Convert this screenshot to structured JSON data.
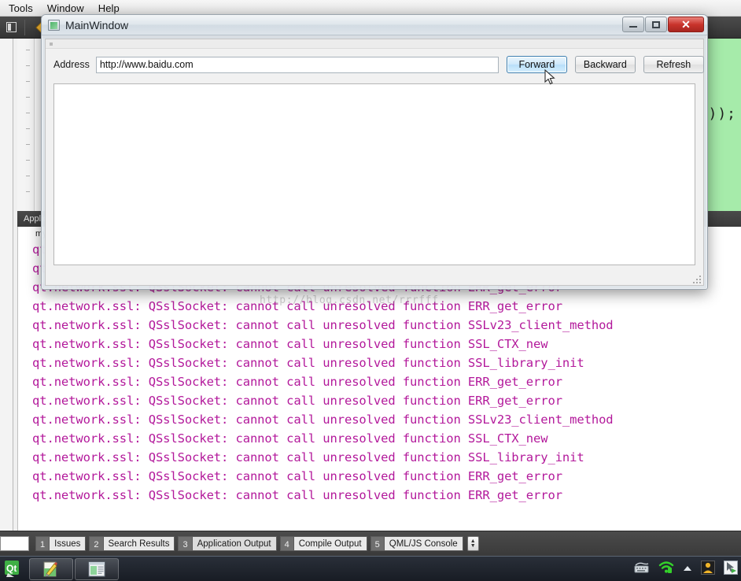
{
  "ide": {
    "menubar": [
      {
        "label": "Tools"
      },
      {
        "label": "Window"
      },
      {
        "label": "Help"
      }
    ],
    "toolbar_icons": [
      {
        "name": "panel-toggle-icon",
        "glyph": "▣"
      },
      {
        "name": "diamond-marker-icon",
        "glyph": "♦"
      }
    ],
    "editor": {
      "code_fragment": "));"
    },
    "output_pane": {
      "tab_label": "Application Output",
      "first_line": "myW",
      "log_prefix": "qt.network.ssl: QSslSocket: cannot call unresolved function ",
      "log_lines": [
        "qt.network.ssl: QSslSocket: cannot call unresolved function ERR_get_error",
        "qt.network.ssl: QSslSocket: cannot call unresolved function ERR_get_error",
        "qt.network.ssl: QSslSocket: cannot call unresolved function ERR_get_error",
        "qt.network.ssl: QSslSocket: cannot call unresolved function ERR_get_error",
        "qt.network.ssl: QSslSocket: cannot call unresolved function SSLv23_client_method",
        "qt.network.ssl: QSslSocket: cannot call unresolved function SSL_CTX_new",
        "qt.network.ssl: QSslSocket: cannot call unresolved function SSL_library_init",
        "qt.network.ssl: QSslSocket: cannot call unresolved function ERR_get_error",
        "qt.network.ssl: QSslSocket: cannot call unresolved function ERR_get_error",
        "qt.network.ssl: QSslSocket: cannot call unresolved function SSLv23_client_method",
        "qt.network.ssl: QSslSocket: cannot call unresolved function SSL_CTX_new",
        "qt.network.ssl: QSslSocket: cannot call unresolved function SSL_library_init",
        "qt.network.ssl: QSslSocket: cannot call unresolved function ERR_get_error",
        "qt.network.ssl: QSslSocket: cannot call unresolved function ERR_get_error"
      ],
      "log_color": "#b3199b"
    },
    "watermark": "http://blog.csdn.net/rrrfff",
    "statusbar": {
      "filter_value": "",
      "tabs": [
        {
          "num": "1",
          "label": "Issues"
        },
        {
          "num": "2",
          "label": "Search Results"
        },
        {
          "num": "3",
          "label": "Application Output"
        },
        {
          "num": "4",
          "label": "Compile Output"
        },
        {
          "num": "5",
          "label": "QML/JS Console"
        }
      ],
      "spinner_up": "▲",
      "spinner_down": "▼"
    }
  },
  "dialog": {
    "title": "MainWindow",
    "icon": "app-window-icon",
    "window_controls": {
      "minimize": "minimize-icon",
      "maximize": "maximize-icon",
      "close": "close-icon",
      "close_glyph": "✕"
    },
    "address_label": "Address",
    "address_value": "http://www.baidu.com",
    "address_placeholder": "",
    "buttons": [
      {
        "label": "Forward",
        "focused": true
      },
      {
        "label": "Backward",
        "focused": false
      },
      {
        "label": "Refresh",
        "focused": false
      }
    ]
  },
  "taskbar": {
    "start_label": "Qt",
    "tasks": [
      {
        "name": "notepadpp-task-icon"
      },
      {
        "name": "mainwindow-task-icon"
      }
    ],
    "tray": [
      {
        "name": "keyboard-icon",
        "glyph": "⌨"
      },
      {
        "name": "wifi-icon",
        "glyph": "●"
      },
      {
        "name": "show-hidden-icons-chevron",
        "glyph": "▲"
      },
      {
        "name": "user-account-icon",
        "glyph": "☺"
      },
      {
        "name": "cursor-tool-icon",
        "glyph": "➤"
      }
    ]
  },
  "colors": {
    "log_magenta": "#b3199b",
    "code_green": "#a6ebaa",
    "focus_blue": "#3c7fb1",
    "close_red": "#c8332b"
  }
}
